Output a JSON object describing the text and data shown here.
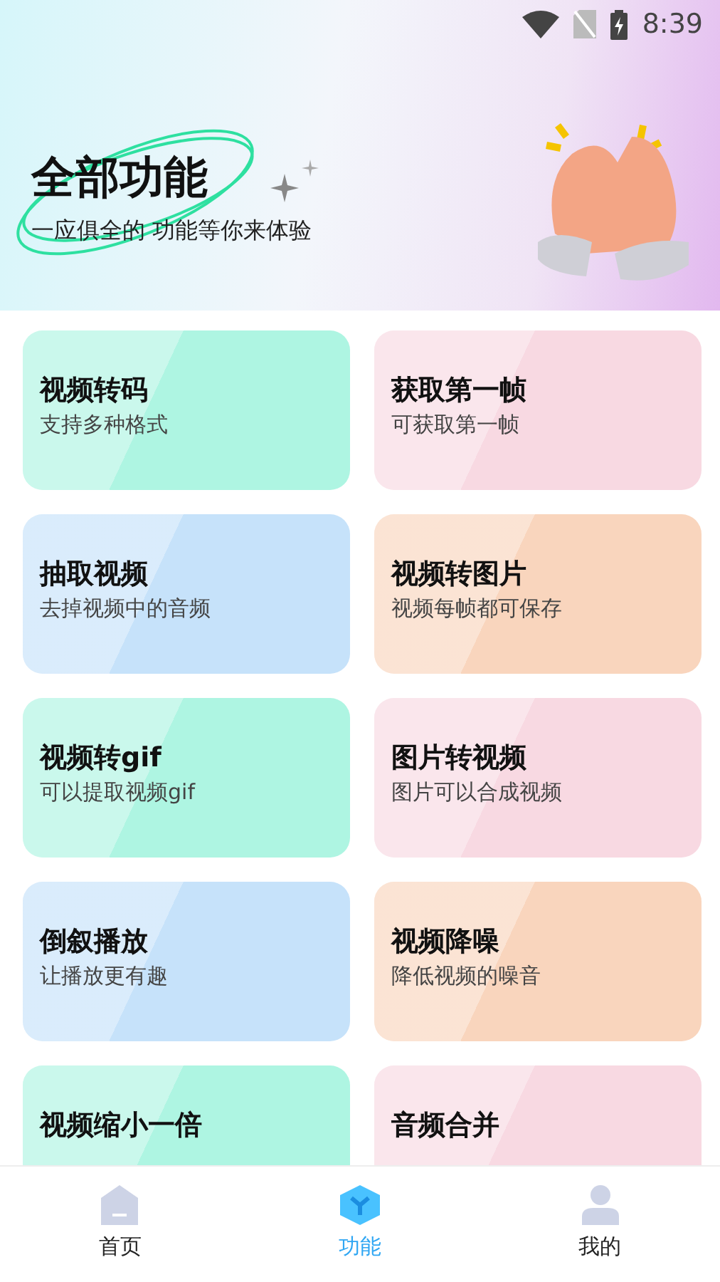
{
  "status_bar": {
    "time": "8:39"
  },
  "header": {
    "title": "全部功能",
    "subtitle": "一应俱全的 功能等你来体验"
  },
  "features": [
    {
      "title": "视频转码",
      "subtitle": "支持多种格式",
      "color": "#aef5e2"
    },
    {
      "title": "获取第一帧",
      "subtitle": "可获取第一帧",
      "color": "#f8d9e2"
    },
    {
      "title": "抽取视频",
      "subtitle": "去掉视频中的音频",
      "color": "#c6e2fa"
    },
    {
      "title": "视频转图片",
      "subtitle": "视频每帧都可保存",
      "color": "#f9d5bd"
    },
    {
      "title": "视频转gif",
      "subtitle": "可以提取视频gif",
      "color": "#aef5e2"
    },
    {
      "title": "图片转视频",
      "subtitle": "图片可以合成视频",
      "color": "#f8d9e2"
    },
    {
      "title": "倒叙播放",
      "subtitle": "让播放更有趣",
      "color": "#c6e2fa"
    },
    {
      "title": "视频降噪",
      "subtitle": "降低视频的噪音",
      "color": "#f9d5bd"
    },
    {
      "title": "视频缩小一倍",
      "color": "#aef5e2"
    },
    {
      "title": "音频合并",
      "color": "#f8d9e2"
    }
  ],
  "bottom_nav": [
    {
      "label": "首页",
      "kind": "home",
      "selected": false
    },
    {
      "label": "功能",
      "kind": "features",
      "selected": true
    },
    {
      "label": "我的",
      "kind": "profile",
      "selected": false
    }
  ]
}
